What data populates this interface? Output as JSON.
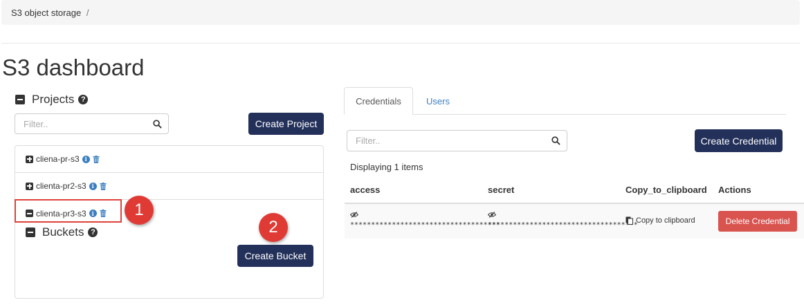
{
  "breadcrumb": {
    "root": "S3 object storage",
    "separator": "/"
  },
  "page": {
    "title": "S3 dashboard"
  },
  "projects": {
    "heading": "Projects",
    "filter_placeholder": "Filter..",
    "create_label": "Create Project",
    "items": [
      {
        "name": "cliena-pr-s3",
        "expanded": false
      },
      {
        "name": "clienta-pr2-s3",
        "expanded": false
      },
      {
        "name": "clienta-pr3-s3",
        "expanded": true
      }
    ]
  },
  "buckets": {
    "heading": "Buckets",
    "create_label": "Create Bucket"
  },
  "annotations": {
    "badge1": "1",
    "badge2": "2",
    "highlight_color": "#e0403a"
  },
  "tabs": [
    {
      "label": "Credentials",
      "active": true
    },
    {
      "label": "Users",
      "active": false
    }
  ],
  "credentials": {
    "filter_placeholder": "Filter..",
    "create_label": "Create Credential",
    "count_text": "Displaying 1 items",
    "columns": [
      "access",
      "secret",
      "Copy_to_clipboard",
      "Actions"
    ],
    "rows": [
      {
        "access": "************************************",
        "secret": "************************************",
        "copy_label": "Copy to clipboard",
        "delete_label": "Delete Credential"
      }
    ]
  },
  "colors": {
    "primary": "#23305a",
    "danger": "#d9534f",
    "link": "#3c7fc1"
  }
}
